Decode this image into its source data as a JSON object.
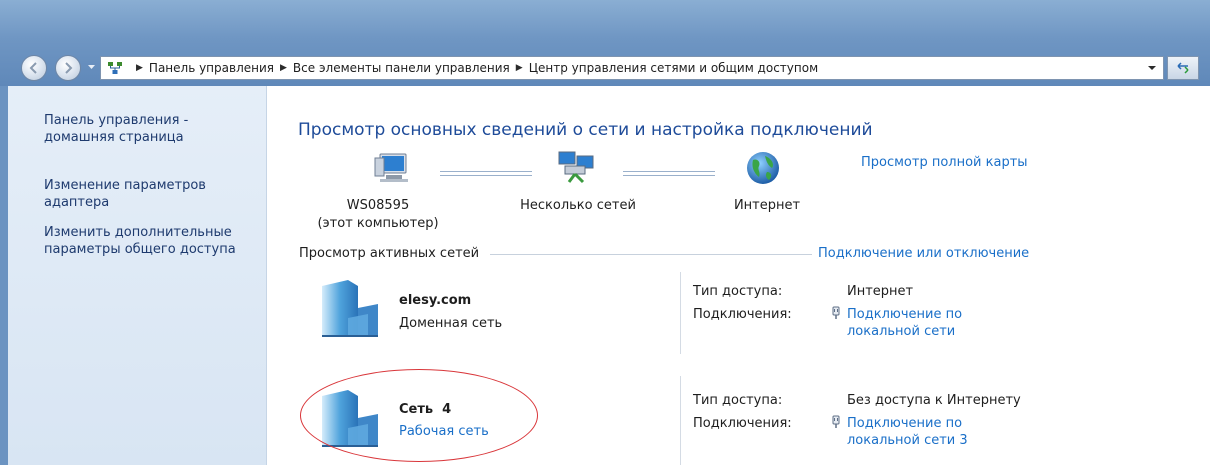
{
  "window": {
    "breadcrumb": [
      "Панель управления",
      "Все элементы панели управления",
      "Центр управления сетями и общим доступом"
    ]
  },
  "icons": {
    "back": "back-arrow-icon",
    "forward": "forward-arrow-icon",
    "address": "network-center-icon",
    "refresh": "refresh-icon",
    "dropdown": "chevron-down-icon"
  },
  "sidebar": {
    "items": [
      {
        "label": "Панель управления - домашняя страница"
      },
      {
        "label": "Изменение параметров адаптера"
      },
      {
        "label": "Изменить дополнительные параметры общего доступа"
      }
    ]
  },
  "main": {
    "title": "Просмотр основных сведений о сети и настройка подключений",
    "map_link": "Просмотр полной карты",
    "map": {
      "computer_name": "WS08595",
      "computer_note": "(этот компьютер)",
      "multi_networks": "Несколько сетей",
      "internet": "Интернет"
    },
    "active_networks_label": "Просмотр активных сетей",
    "connect_link": "Подключение или отключение",
    "networks": [
      {
        "name": "elesy.com",
        "type": "Доменная сеть",
        "access_label": "Тип доступа:",
        "access_value": "Интернет",
        "conn_label": "Подключения:",
        "conn_value": "Подключение по локальной сети"
      },
      {
        "name": "Сеть  4",
        "type": "Рабочая сеть",
        "access_label": "Тип доступа:",
        "access_value": "Без доступа к Интернету",
        "conn_label": "Подключения:",
        "conn_value": "Подключение по локальной сети 3"
      }
    ]
  },
  "colors": {
    "link": "#1a6fc8",
    "title": "#1e4b99",
    "highlight": "#d9363a",
    "sidebar_bg": "#dfe9f5"
  }
}
